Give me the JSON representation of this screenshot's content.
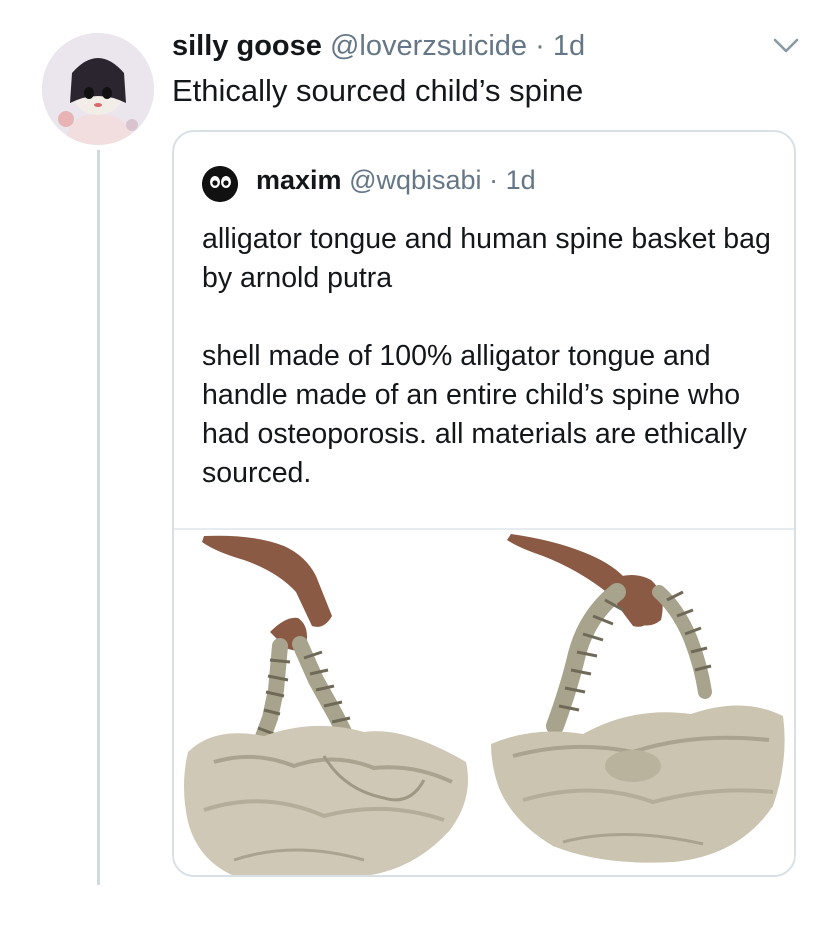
{
  "tweet": {
    "display_name": "silly goose",
    "handle": "@loverzsuicide",
    "separator": "·",
    "time": "1d",
    "text": "Ethically sourced child’s spine",
    "avatar_icon": "user-avatar-icon",
    "menu_icon": "chevron-down-icon"
  },
  "quoted_tweet": {
    "display_name": "maxim",
    "handle": "@wqbisabi",
    "separator": "·",
    "time": "1d",
    "paragraph_1": "alligator tongue and human spine basket bag by arnold putra",
    "paragraph_2": "shell made of 100% alligator tongue and handle made of an entire child’s spine who had osteoporosis. all materials are ethically sourced.",
    "avatar_icon": "user-avatar-icon",
    "media": [
      "bag-photo-icon",
      "bag-photo-icon"
    ]
  },
  "colors": {
    "text_primary": "#14171a",
    "text_secondary": "#657786",
    "border": "#d8e0e6",
    "thread_line": "#cfd9de"
  }
}
